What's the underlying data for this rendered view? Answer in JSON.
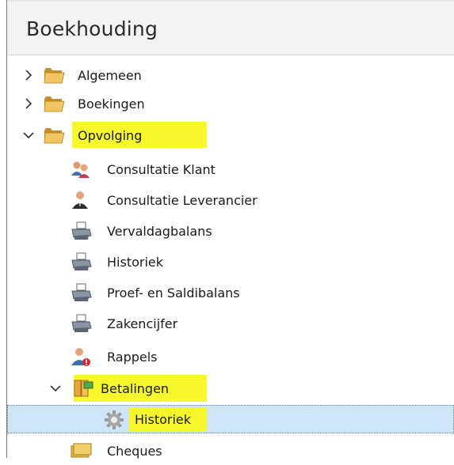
{
  "panel": {
    "title": "Boekhouding"
  },
  "tree": [
    {
      "label": "Algemeen",
      "icon": "folder-icon",
      "expander": "collapsed"
    },
    {
      "label": "Boekingen",
      "icon": "folder-icon",
      "expander": "collapsed"
    },
    {
      "label": "Opvolging",
      "icon": "folder-icon",
      "expander": "expanded",
      "highlighted": true
    },
    {
      "label": "Consultatie Klant",
      "icon": "customers-icon"
    },
    {
      "label": "Consultatie Leverancier",
      "icon": "supplier-icon"
    },
    {
      "label": "Vervaldagbalans",
      "icon": "printer-icon"
    },
    {
      "label": "Historiek",
      "icon": "printer-icon"
    },
    {
      "label": "Proef- en Saldibalans",
      "icon": "printer-icon"
    },
    {
      "label": "Zakencijfer",
      "icon": "printer-icon"
    },
    {
      "label": "Rappels",
      "icon": "reminder-user-icon"
    },
    {
      "label": "Betalingen",
      "icon": "payments-icon",
      "expander": "expanded",
      "highlighted": true
    },
    {
      "label": "Historiek",
      "icon": "gear-icon",
      "selected": true,
      "highlighted": true
    },
    {
      "label": "Cheques",
      "icon": "cheques-icon"
    }
  ],
  "colors": {
    "highlight": "#f6f82b",
    "selection": "#cfe5f8",
    "folder": "#e8b64c"
  }
}
